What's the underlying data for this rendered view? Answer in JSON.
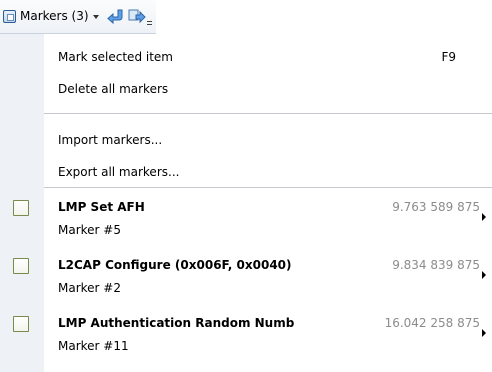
{
  "toolbar": {
    "title": "Markers (3)",
    "icons": [
      "marker-icon",
      "dropdown-caret-icon",
      "previous-marker-icon",
      "next-marker-icon",
      "toolbar-grip-icon"
    ]
  },
  "menu": {
    "items": [
      {
        "label": "Mark selected item",
        "shortcut": "F9"
      },
      {
        "label": "Delete all markers",
        "shortcut": ""
      },
      {
        "label": "Import markers...",
        "shortcut": ""
      },
      {
        "label": "Export all markers...",
        "shortcut": ""
      }
    ],
    "markers": [
      {
        "name": "LMP Set AFH",
        "sub": "Marker #5",
        "time": "9.763 589 875"
      },
      {
        "name": "L2CAP Configure (0x006F, 0x0040)",
        "sub": "Marker #2",
        "time": "9.834 839 875"
      },
      {
        "name": "LMP Authentication Random Numb",
        "sub": "Marker #11",
        "time": "16.042 258 875"
      }
    ]
  },
  "colors": {
    "gutter": "#eef1f5",
    "separator": "#c5c8cc",
    "time_text": "#8c8c8c",
    "checkbox_border": "#7a8a4a"
  }
}
